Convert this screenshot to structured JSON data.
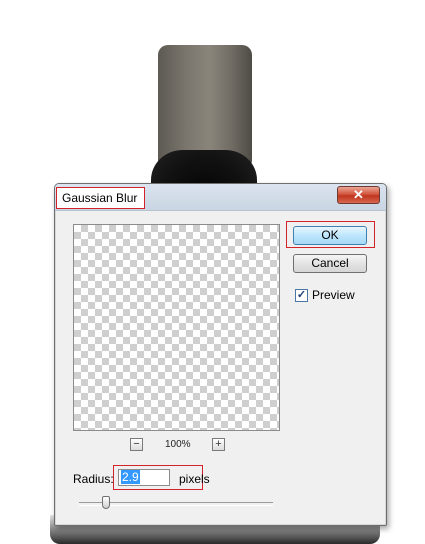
{
  "dialog": {
    "title": "Gaussian Blur",
    "close_glyph": "✕",
    "ok_label": "OK",
    "cancel_label": "Cancel",
    "preview_label": "Preview",
    "preview_checked": true,
    "check_glyph": "✓",
    "zoom_out_glyph": "−",
    "zoom_in_glyph": "+",
    "zoom_level": "100%",
    "radius_label": "Radius:",
    "radius_value": "2.9",
    "units_label": "pixels",
    "slider_fraction": 0.14
  },
  "icons": {
    "close": "close-icon",
    "check": "checkmark-icon",
    "zoom_out": "minus-icon",
    "zoom_in": "plus-icon"
  },
  "colors": {
    "highlight_outline": "#d2232a",
    "ok_button": "#bee6fd",
    "close_button": "#c0351f",
    "selection": "#3399ff"
  }
}
